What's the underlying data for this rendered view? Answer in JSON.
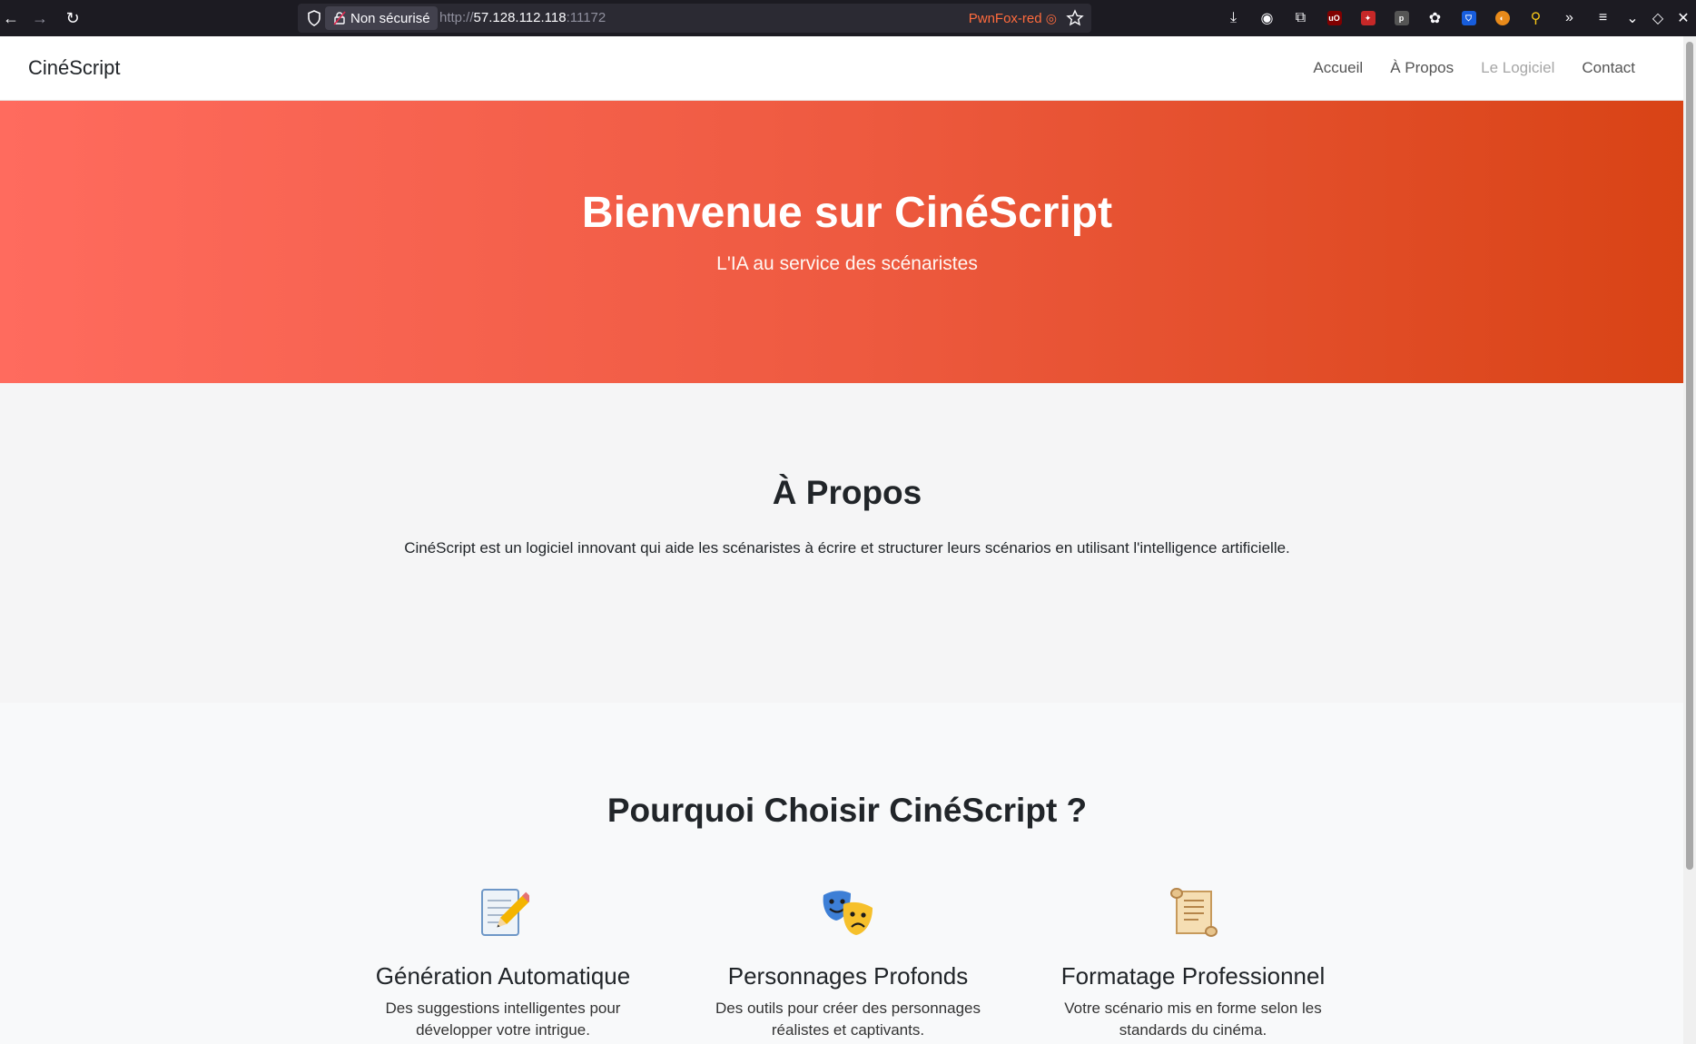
{
  "browser": {
    "security_label": "Non sécurisé",
    "url_scheme": "http://",
    "url_host": "57.128.112.118",
    "url_port": ":11172",
    "container_label": "PwnFox-red"
  },
  "site": {
    "brand": "CinéScript",
    "nav": [
      {
        "label": "Accueil"
      },
      {
        "label": "À Propos"
      },
      {
        "label": "Le Logiciel"
      },
      {
        "label": "Contact"
      }
    ]
  },
  "hero": {
    "title": "Bienvenue sur CinéScript",
    "subtitle": "L'IA au service des scénaristes"
  },
  "about": {
    "title": "À Propos",
    "text": "CinéScript est un logiciel innovant qui aide les scénaristes à écrire et structurer leurs scénarios en utilisant l'intelligence artificielle."
  },
  "features": {
    "title": "Pourquoi Choisir CinéScript ?",
    "items": [
      {
        "icon": "memo-icon",
        "title": "Génération Automatique",
        "text": "Des suggestions intelligentes pour développer votre intrigue."
      },
      {
        "icon": "theater-masks-icon",
        "title": "Personnages Profonds",
        "text": "Des outils pour créer des personnages réalistes et captivants."
      },
      {
        "icon": "scroll-icon",
        "title": "Formatage Professionnel",
        "text": "Votre scénario mis en forme selon les standards du cinéma."
      }
    ]
  },
  "colors": {
    "hero_gradient_start": "#ff6b5e",
    "hero_gradient_end": "#d84315",
    "container_red": "#ff6b3d"
  }
}
